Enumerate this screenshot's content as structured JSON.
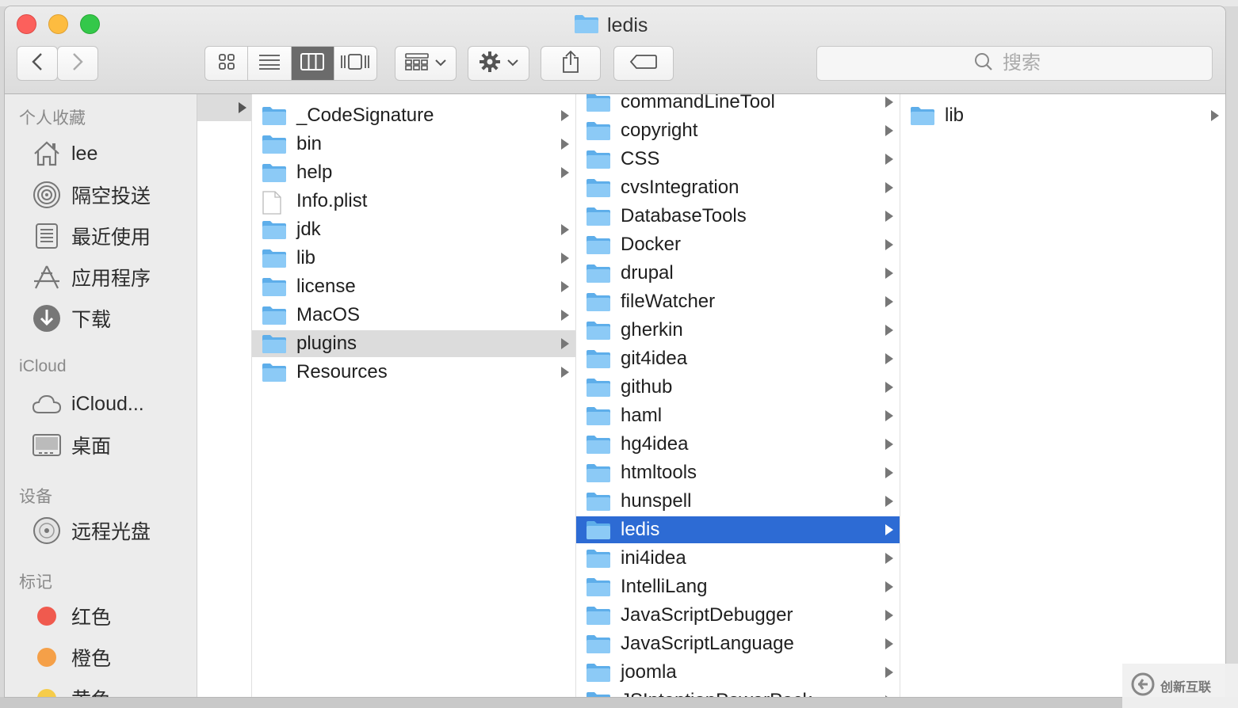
{
  "window": {
    "title": "ledis"
  },
  "toolbar": {
    "back_icon": "chevron-left-icon",
    "forward_icon": "chevron-right-icon",
    "views": [
      "icon-view",
      "list-view",
      "column-view",
      "cover-flow-view"
    ],
    "active_view": "column-view",
    "search_placeholder": "搜索"
  },
  "sidebar": {
    "sections": [
      {
        "title": "个人收藏",
        "items": [
          {
            "label": "lee",
            "icon": "home-icon"
          },
          {
            "label": "隔空投送",
            "icon": "airdrop-icon"
          },
          {
            "label": "最近使用",
            "icon": "recents-icon"
          },
          {
            "label": "应用程序",
            "icon": "applications-icon"
          },
          {
            "label": "下载",
            "icon": "download-icon"
          }
        ]
      },
      {
        "title": "iCloud",
        "items": [
          {
            "label": "iCloud...",
            "icon": "cloud-icon"
          },
          {
            "label": "桌面",
            "icon": "desktop-icon"
          }
        ]
      },
      {
        "title": "设备",
        "items": [
          {
            "label": "远程光盘",
            "icon": "disc-icon"
          }
        ]
      },
      {
        "title": "标记",
        "items": [
          {
            "label": "红色",
            "color": "#f05a4e"
          },
          {
            "label": "橙色",
            "color": "#f5a048"
          },
          {
            "label": "黄色",
            "color": "#f6cc4a"
          }
        ]
      }
    ]
  },
  "columns": {
    "col1": [
      {
        "name": "_CodeSignature",
        "type": "folder",
        "arrow": true
      },
      {
        "name": "bin",
        "type": "folder",
        "arrow": true
      },
      {
        "name": "help",
        "type": "folder",
        "arrow": true
      },
      {
        "name": "Info.plist",
        "type": "file",
        "arrow": false
      },
      {
        "name": "jdk",
        "type": "folder",
        "arrow": true
      },
      {
        "name": "lib",
        "type": "folder",
        "arrow": true
      },
      {
        "name": "license",
        "type": "folder",
        "arrow": true
      },
      {
        "name": "MacOS",
        "type": "folder",
        "arrow": true
      },
      {
        "name": "plugins",
        "type": "folder",
        "arrow": true,
        "selected": "gray"
      },
      {
        "name": "Resources",
        "type": "folder",
        "arrow": true
      }
    ],
    "col2": [
      {
        "name": "commandLineTool",
        "type": "folder",
        "arrow": true
      },
      {
        "name": "copyright",
        "type": "folder",
        "arrow": true
      },
      {
        "name": "CSS",
        "type": "folder",
        "arrow": true
      },
      {
        "name": "cvsIntegration",
        "type": "folder",
        "arrow": true
      },
      {
        "name": "DatabaseTools",
        "type": "folder",
        "arrow": true
      },
      {
        "name": "Docker",
        "type": "folder",
        "arrow": true
      },
      {
        "name": "drupal",
        "type": "folder",
        "arrow": true
      },
      {
        "name": "fileWatcher",
        "type": "folder",
        "arrow": true
      },
      {
        "name": "gherkin",
        "type": "folder",
        "arrow": true
      },
      {
        "name": "git4idea",
        "type": "folder",
        "arrow": true
      },
      {
        "name": "github",
        "type": "folder",
        "arrow": true
      },
      {
        "name": "haml",
        "type": "folder",
        "arrow": true
      },
      {
        "name": "hg4idea",
        "type": "folder",
        "arrow": true
      },
      {
        "name": "htmltools",
        "type": "folder",
        "arrow": true
      },
      {
        "name": "hunspell",
        "type": "folder",
        "arrow": true
      },
      {
        "name": "ledis",
        "type": "folder",
        "arrow": true,
        "selected": "blue"
      },
      {
        "name": "ini4idea",
        "type": "folder",
        "arrow": true
      },
      {
        "name": "IntelliLang",
        "type": "folder",
        "arrow": true
      },
      {
        "name": "JavaScriptDebugger",
        "type": "folder",
        "arrow": true
      },
      {
        "name": "JavaScriptLanguage",
        "type": "folder",
        "arrow": true
      },
      {
        "name": "joomla",
        "type": "folder",
        "arrow": true
      },
      {
        "name": "JSIntentionPowerPack",
        "type": "folder",
        "arrow": true
      }
    ],
    "col3": [
      {
        "name": "lib",
        "type": "folder",
        "arrow": true
      }
    ]
  },
  "watermark": {
    "text": "创新互联"
  },
  "colors": {
    "selection_blue": "#2d6bd4",
    "selection_gray": "#dcdcdc",
    "folder": "#6cb8f0"
  }
}
